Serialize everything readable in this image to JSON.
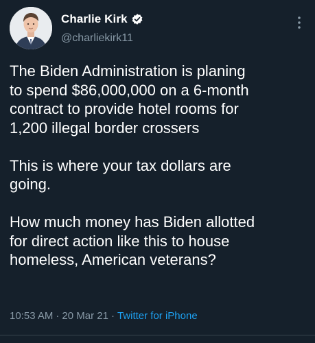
{
  "author": {
    "display_name": "Charlie Kirk",
    "handle": "@charliekirk11",
    "verified": true,
    "avatar_icon": "person-avatar"
  },
  "tweet": {
    "paragraphs": [
      "The Biden Administration is planing\nto spend $86,000,000 on a 6-month\ncontract to provide hotel rooms for\n1,200 illegal border crossers",
      "This is where your tax dollars are\ngoing.",
      "How much money has Biden allotted\nfor direct action like this to house\nhomeless, American veterans?"
    ],
    "time": "10:53 AM",
    "date": "20 Mar 21",
    "separator": "·",
    "source": "Twitter for iPhone"
  },
  "icons": {
    "verified": "verified-badge-icon",
    "more": "more-options-icon"
  },
  "colors": {
    "background": "#15202b",
    "text": "#ffffff",
    "secondary_text": "#8899a6",
    "accent": "#1da1f2",
    "divider": "#38444d"
  }
}
